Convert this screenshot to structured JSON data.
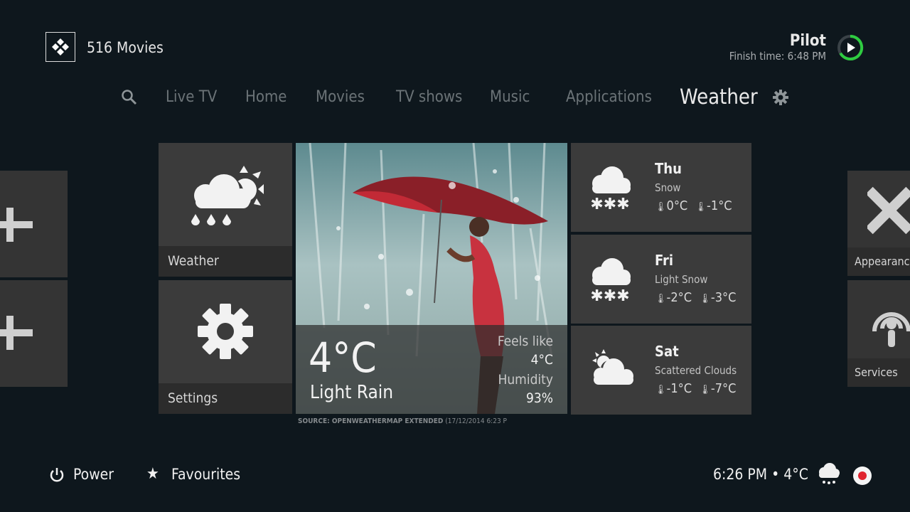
{
  "header": {
    "app_title": "516 Movies",
    "now_playing_title": "Pilot",
    "now_playing_finish": "Finish time: 6:48 PM"
  },
  "nav": {
    "items": [
      "Live TV",
      "Home",
      "Movies",
      "TV shows",
      "Music",
      "Applications",
      "Weather"
    ],
    "active": "Weather"
  },
  "tiles": {
    "weather_label": "Weather",
    "settings_label": "Settings",
    "appearance_label": "Appearance",
    "services_label": "Services"
  },
  "current": {
    "temperature": "4°C",
    "condition": "Light Rain",
    "feels_like_label": "Feels like",
    "feels_like_value": "4°C",
    "humidity_label": "Humidity",
    "humidity_value": "93%",
    "source_bold": "SOURCE: OPENWEATHERMAP EXTENDED",
    "source_rest": " (17/12/2014 6:23 P"
  },
  "forecast": [
    {
      "day": "Thu",
      "condition": "Snow",
      "high": "0°C",
      "low": "-1°C",
      "icon": "snow-icon"
    },
    {
      "day": "Fri",
      "condition": "Light Snow",
      "high": "-2°C",
      "low": "-3°C",
      "icon": "snow-icon"
    },
    {
      "day": "Sat",
      "condition": "Scattered Clouds",
      "high": "-1°C",
      "low": "-7°C",
      "icon": "scattered-clouds-icon"
    }
  ],
  "footer": {
    "power_label": "Power",
    "favourites_label": "Favourites",
    "status": "6:26 PM • 4°C"
  },
  "colors": {
    "background": "#0e171d",
    "tile": "#3b3b3b",
    "progress_ring": "#2ecc40",
    "record_dot": "#e0242f"
  }
}
